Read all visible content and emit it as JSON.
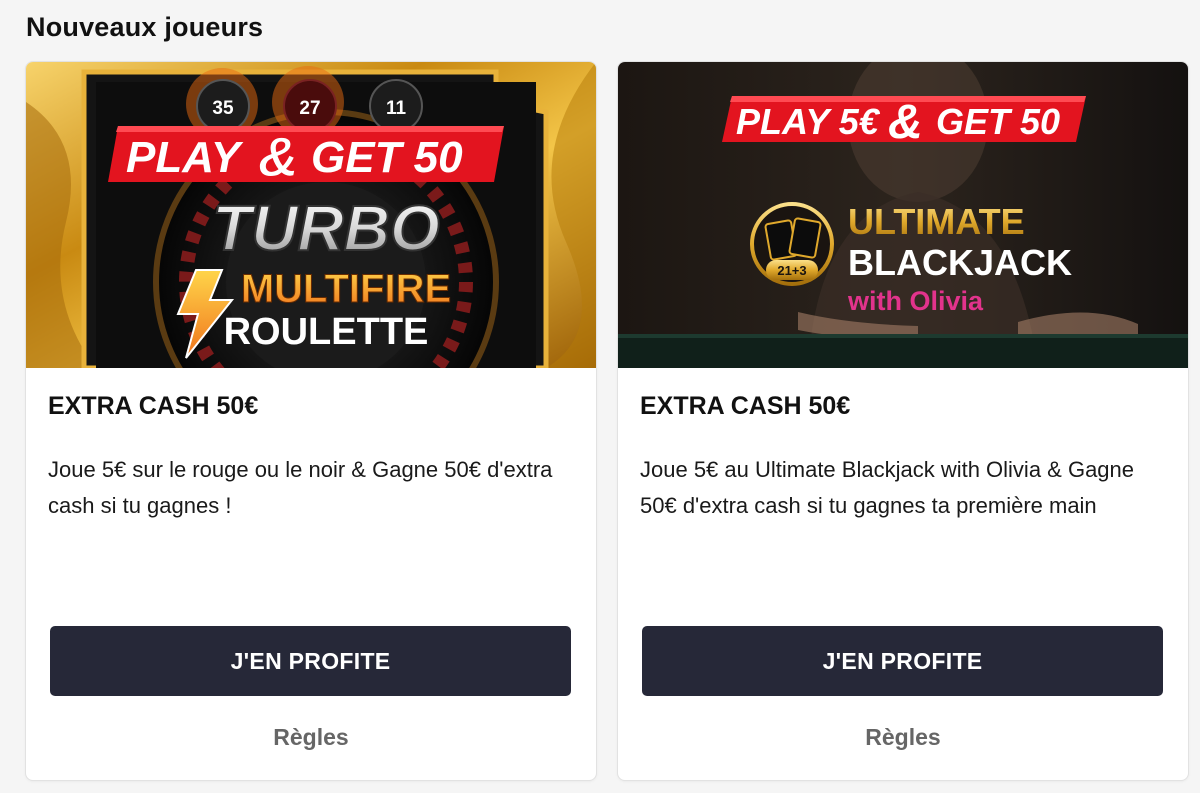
{
  "section": {
    "title": "Nouveaux joueurs"
  },
  "colors": {
    "button_bg": "#262838",
    "promo_red": "#e3141f",
    "gold": "#e9a316",
    "pink": "#e2338c"
  },
  "cards": [
    {
      "banner": {
        "promo_play": "PLAY",
        "promo_amp": "&",
        "promo_get": "GET 50",
        "game_line1": "TURBO",
        "game_line2": "MULTIFIRE",
        "game_line3": "ROULETTE",
        "balls": [
          "35",
          "27",
          "11"
        ]
      },
      "title": "EXTRA CASH 50€",
      "description": "Joue 5€ sur le rouge ou le noir & Gagne 50€ d'extra cash si tu gagnes !",
      "cta_label": "J'EN PROFITE",
      "rules_label": "Règles"
    },
    {
      "banner": {
        "promo_play": "PLAY 5€",
        "promo_amp": "&",
        "promo_get": "GET 50",
        "game_line1": "ULTIMATE",
        "game_line2": "BLACKJACK",
        "game_line3": "with Olivia",
        "badge": "21+3"
      },
      "title": "EXTRA CASH 50€",
      "description": "Joue 5€ au Ultimate Blackjack with Olivia & Gagne 50€ d'extra cash si tu gagnes ta première main",
      "cta_label": "J'EN PROFITE",
      "rules_label": "Règles"
    }
  ]
}
